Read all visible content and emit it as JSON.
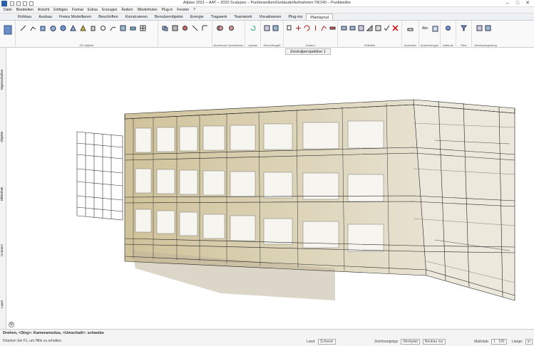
{
  "title": "Allplan 2021 – AAT – 2020 Scalypso – Punktewolken/Gebäude/Aufnahmen:78/140 – Punktwolke",
  "menu": [
    "Datei",
    "Bearbeiten",
    "Ansicht",
    "Einfügen",
    "Format",
    "Extras",
    "Erzeugen",
    "Ändern",
    "Wiederholen",
    "Plug-in",
    "Fenster",
    "?"
  ],
  "tabs": [
    "Rohbau",
    "Ausbau",
    "Freies Modellieren",
    "Beschriften",
    "Konstruieren",
    "Benutzerobjekte",
    "Energie",
    "Tragwerk",
    "Teamwork",
    "Visualisieren",
    "Plug-ins",
    "Planlayout"
  ],
  "active_tab": "Planlayout",
  "ribbon_groups": [
    "3D-Objekte",
    "Boolesche Operationen",
    "Update",
    "Schnellzugriff",
    "Ändern",
    "Teilbilder",
    "Ansichten",
    "Auswertungen",
    "Attribute",
    "Filter",
    "Arbeitsumgebung"
  ],
  "view_tab": "Zentralperspektive 1",
  "side_tabs": [
    "Eigenschaften",
    "Objekte",
    "Bibliothek",
    "Connect",
    "Layer"
  ],
  "status": {
    "hint_primary": "Drehen, <Strg>: Kameramodus, <Umschalt>: schwebe",
    "hint_secondary": "Drücken Sie F1, um Hilfe zu erhalten.",
    "land_label": "Land:",
    "land_value": "Schweiz",
    "zeichnungstyp_label": "Zeichnungstyp:",
    "zeichnungstyp_value": "Werkplan",
    "bauwerk_value": "Neubau nur",
    "massstab_label": "Maßstab:",
    "massstab_value": "1 : 100",
    "laenge_label": "Länge:",
    "laenge_value": "m"
  }
}
